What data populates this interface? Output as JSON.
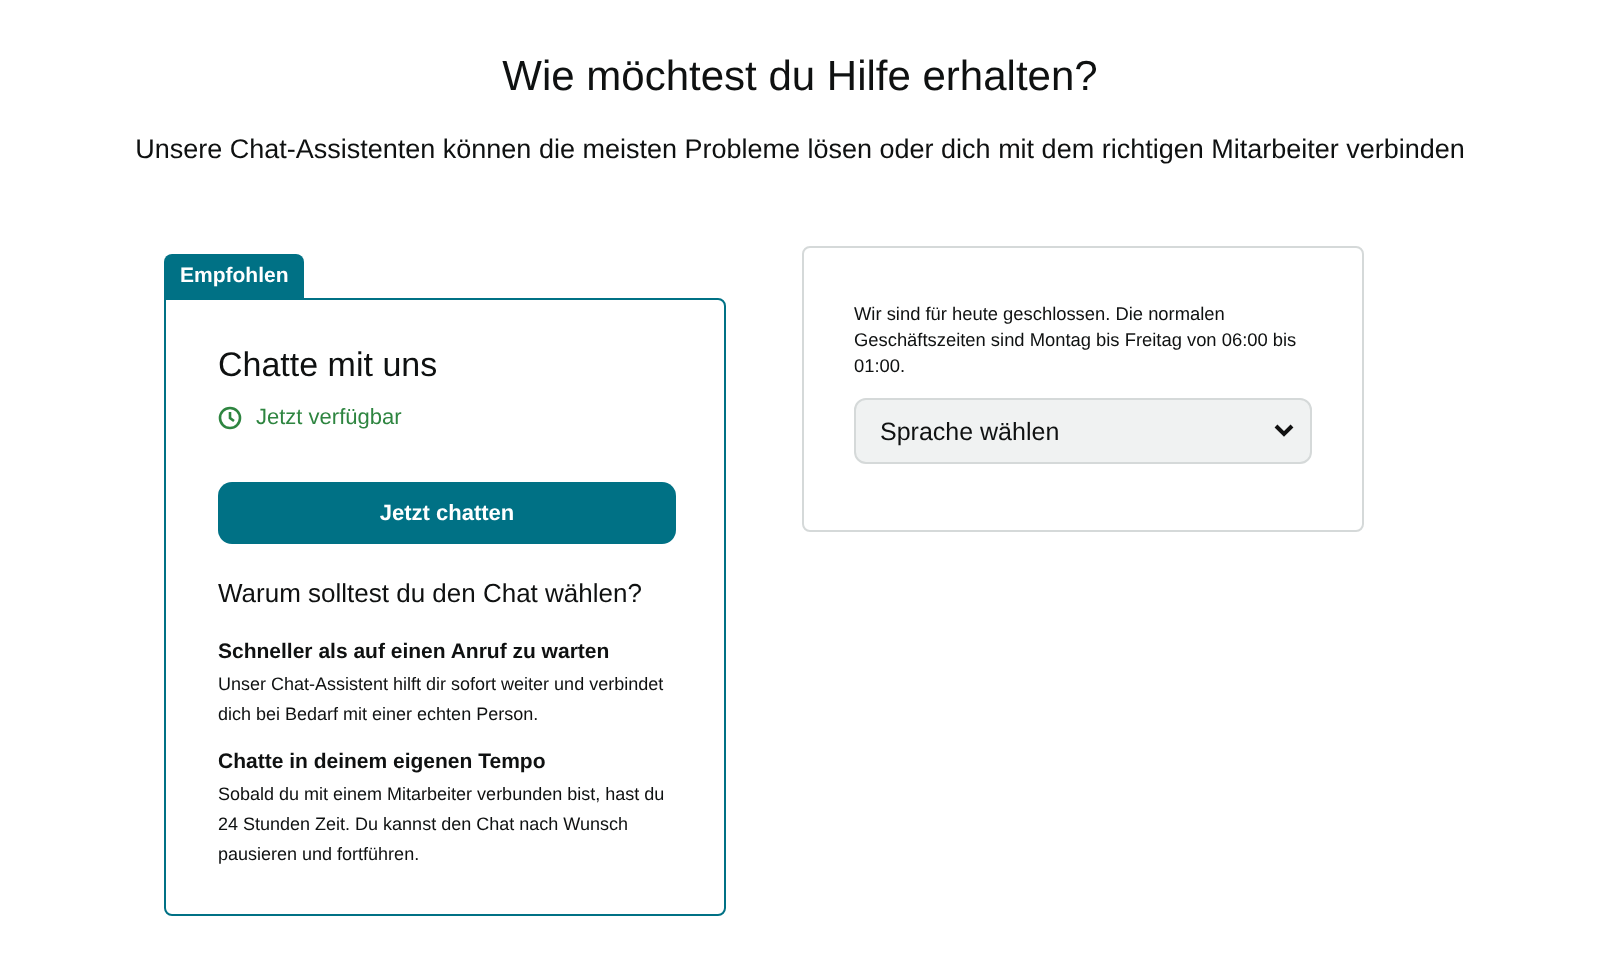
{
  "title": "Wie möchtest du Hilfe erhalten?",
  "subtitle": "Unsere Chat-Assistenten können die meisten Probleme lösen oder dich mit dem richtigen Mitarbeiter verbinden",
  "chat_card": {
    "badge": "Empfohlen",
    "heading": "Chatte mit uns",
    "availability": "Jetzt verfügbar",
    "button": "Jetzt chatten",
    "why_heading": "Warum solltest du den Chat wählen?",
    "reasons": [
      {
        "title": "Schneller als auf einen Anruf zu warten",
        "text": "Unser Chat-Assistent hilft dir sofort weiter und verbindet dich bei Bedarf mit einer echten Person."
      },
      {
        "title": "Chatte in deinem eigenen Tempo",
        "text": "Sobald du mit einem Mitarbeiter verbunden bist, hast du 24 Stunden Zeit. Du kannst den Chat nach Wunsch pausieren und fortführen."
      }
    ]
  },
  "phone_card": {
    "notice": "Wir sind für heute geschlossen. Die normalen Geschäftszeiten sind Montag bis Freitag von 06:00 bis 01:00.",
    "language_select": {
      "placeholder": "Sprache wählen"
    }
  }
}
